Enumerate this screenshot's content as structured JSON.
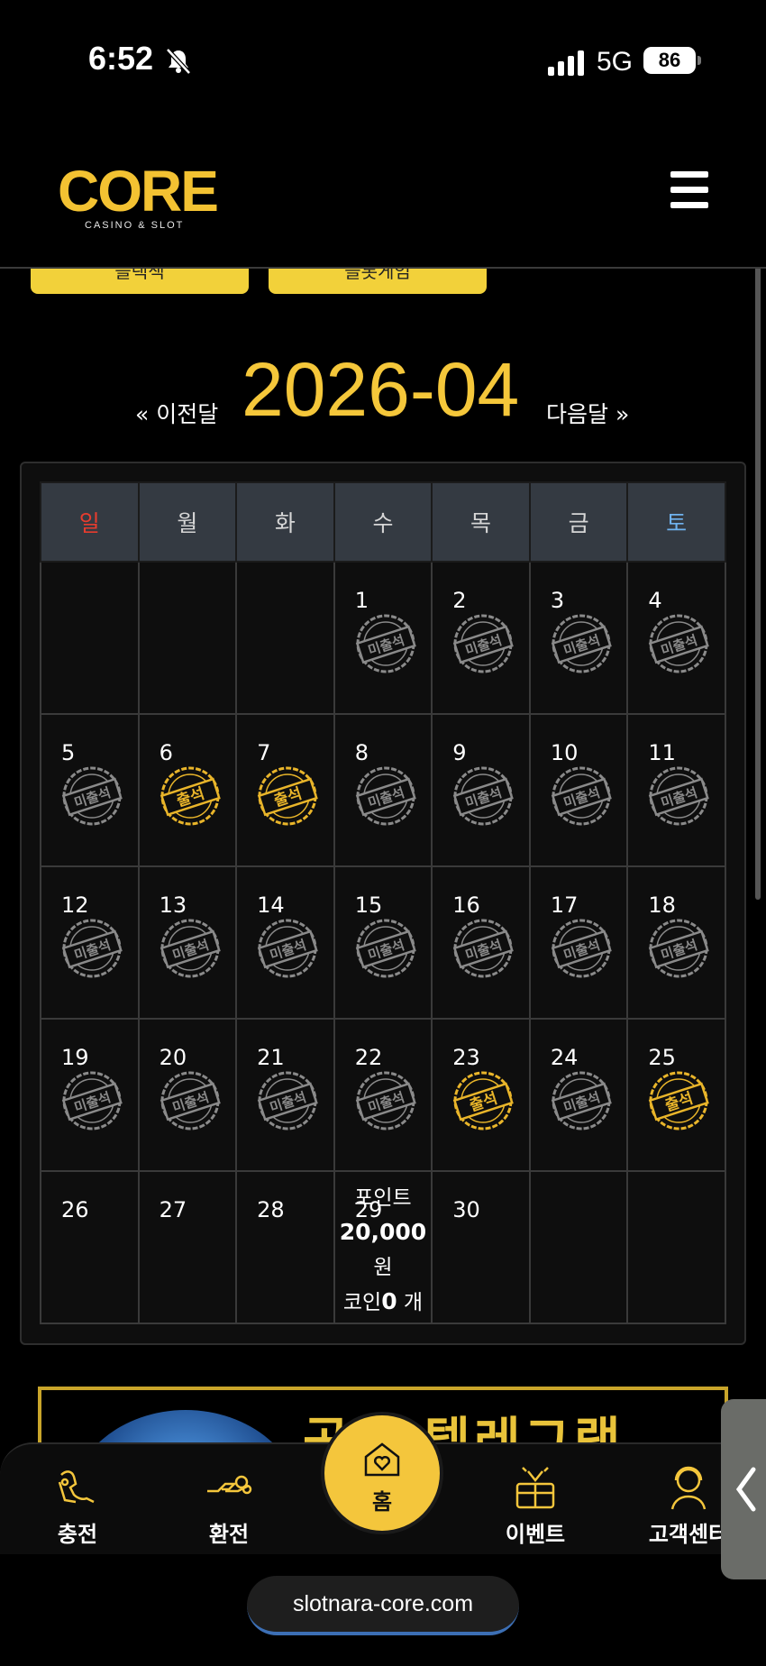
{
  "status": {
    "time": "6:52",
    "network": "5G",
    "battery": "86"
  },
  "header": {
    "logo_text": "CORE",
    "logo_subtitle": "CASINO & SLOT"
  },
  "top_buttons": [
    "블랙잭",
    "슬롯게임"
  ],
  "calendar": {
    "prev_label": "« 이전달",
    "month": "2026-04",
    "next_label": "다음달 »",
    "weekdays": [
      "일",
      "월",
      "화",
      "수",
      "목",
      "금",
      "토"
    ],
    "stamp_absent": "미출석",
    "stamp_present": "출석",
    "weeks": [
      [
        {
          "day": ""
        },
        {
          "day": ""
        },
        {
          "day": ""
        },
        {
          "day": "1",
          "status": "absent"
        },
        {
          "day": "2",
          "status": "absent"
        },
        {
          "day": "3",
          "status": "absent"
        },
        {
          "day": "4",
          "status": "absent"
        }
      ],
      [
        {
          "day": "5",
          "status": "absent"
        },
        {
          "day": "6",
          "status": "present"
        },
        {
          "day": "7",
          "status": "present"
        },
        {
          "day": "8",
          "status": "absent"
        },
        {
          "day": "9",
          "status": "absent"
        },
        {
          "day": "10",
          "status": "absent"
        },
        {
          "day": "11",
          "status": "absent"
        }
      ],
      [
        {
          "day": "12",
          "status": "absent"
        },
        {
          "day": "13",
          "status": "absent"
        },
        {
          "day": "14",
          "status": "absent"
        },
        {
          "day": "15",
          "status": "absent"
        },
        {
          "day": "16",
          "status": "absent"
        },
        {
          "day": "17",
          "status": "absent"
        },
        {
          "day": "18",
          "status": "absent"
        }
      ],
      [
        {
          "day": "19",
          "status": "absent"
        },
        {
          "day": "20",
          "status": "absent"
        },
        {
          "day": "21",
          "status": "absent"
        },
        {
          "day": "22",
          "status": "absent"
        },
        {
          "day": "23",
          "status": "present"
        },
        {
          "day": "24",
          "status": "absent"
        },
        {
          "day": "25",
          "status": "present"
        }
      ],
      [
        {
          "day": "26"
        },
        {
          "day": "27"
        },
        {
          "day": "28"
        },
        {
          "day": "29",
          "reward": true
        },
        {
          "day": "30"
        },
        {
          "day": ""
        },
        {
          "day": ""
        }
      ]
    ],
    "reward": {
      "point_label": "포인트",
      "point_value": "20,000",
      "point_unit": "원",
      "coin_label": "코인",
      "coin_value": "0",
      "coin_unit": "개"
    }
  },
  "banner": {
    "text": "공식 텔레그램"
  },
  "bottom_nav": {
    "charge": "충전",
    "exchange": "환전",
    "home": "홈",
    "event": "이벤트",
    "support": "고객센터"
  },
  "url": "slotnara-core.com",
  "colors": {
    "accent": "#f4c63c",
    "sunday": "#e73c2e",
    "saturday": "#6fb2ee",
    "header_cell": "#343a42"
  },
  "icons": [
    "bell-off-icon",
    "signal-icon",
    "hamburger-menu-icon",
    "charge-icon",
    "exchange-icon",
    "home-heart-icon",
    "gift-icon",
    "headset-icon",
    "chevron-left-icon"
  ]
}
